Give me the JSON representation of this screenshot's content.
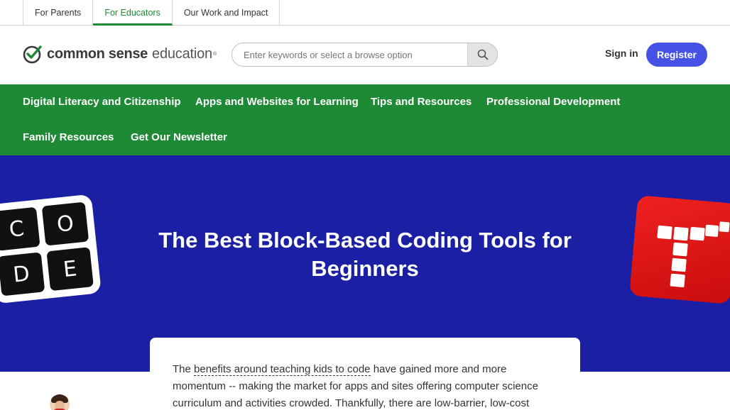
{
  "audience_tabs": [
    {
      "label": "For Parents",
      "active": false
    },
    {
      "label": "For Educators",
      "active": true
    },
    {
      "label": "Our Work and Impact",
      "active": false
    }
  ],
  "header": {
    "logo_bold": "common sense",
    "logo_light": "education",
    "logo_reg": "®",
    "search_placeholder": "Enter keywords or select a browse option",
    "signin_label": "Sign in",
    "register_label": "Register"
  },
  "nav": {
    "items": [
      "Digital Literacy and Citizenship",
      "Apps and Websites for Learning",
      "Tips and Resources",
      "Professional Development",
      "Family Resources",
      "Get Our Newsletter"
    ]
  },
  "hero": {
    "title_line1": "The Best Block-Based Coding Tools for",
    "title_line2": "Beginners",
    "code_letters": [
      "C",
      "O",
      "D",
      "E"
    ]
  },
  "article": {
    "intro_before": "The ",
    "intro_link": "benefits around teaching kids to code",
    "intro_after": " have gained more and more momentum -- making the market for apps and sites offering computer science curriculum and activities crowded. Thankfully, there are low-barrier, low-cost"
  },
  "colors": {
    "brand_green": "#1f8a35",
    "hero_blue": "#1a1fa3",
    "register_blue": "#4652e6",
    "tynker_red": "#e01616"
  },
  "icons": {
    "search": "search-icon",
    "logo_check": "checkmark-logo-icon"
  }
}
